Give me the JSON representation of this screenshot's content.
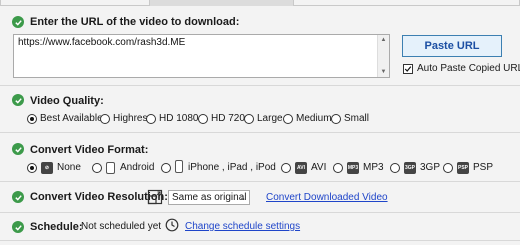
{
  "url_section": {
    "label": "Enter the URL of the video to download:",
    "url_value": "https://www.facebook.com/rash3d.ME",
    "paste_button": "Paste URL",
    "auto_paste_label": "Auto Paste Copied URL",
    "auto_paste_checked": true
  },
  "quality": {
    "label": "Video Quality:",
    "options": [
      "Best Available",
      "Highres",
      "HD 1080",
      "HD 720",
      "Large",
      "Medium",
      "Small"
    ],
    "selected": "Best Available"
  },
  "format": {
    "label": "Convert Video Format:",
    "options": [
      "None",
      "Android",
      "iPhone , iPad , iPod",
      "AVI",
      "MP3",
      "3GP",
      "PSP"
    ],
    "icon_names": [
      "none-icon",
      "android-icon",
      "iphone-icon",
      "avi-icon",
      "mp3-icon",
      "3gp-icon",
      "psp-icon"
    ],
    "selected": "None"
  },
  "resolution": {
    "label": "Convert Video Resolution:",
    "selected": "Same as original",
    "link": "Convert Downloaded Video"
  },
  "schedule": {
    "label": "Schedule:",
    "status": "Not scheduled yet",
    "link": "Change schedule settings"
  },
  "colors": {
    "accent_green": "#3c9a4a",
    "link_blue": "#1f45c9",
    "button_text": "#1c4fa3"
  }
}
